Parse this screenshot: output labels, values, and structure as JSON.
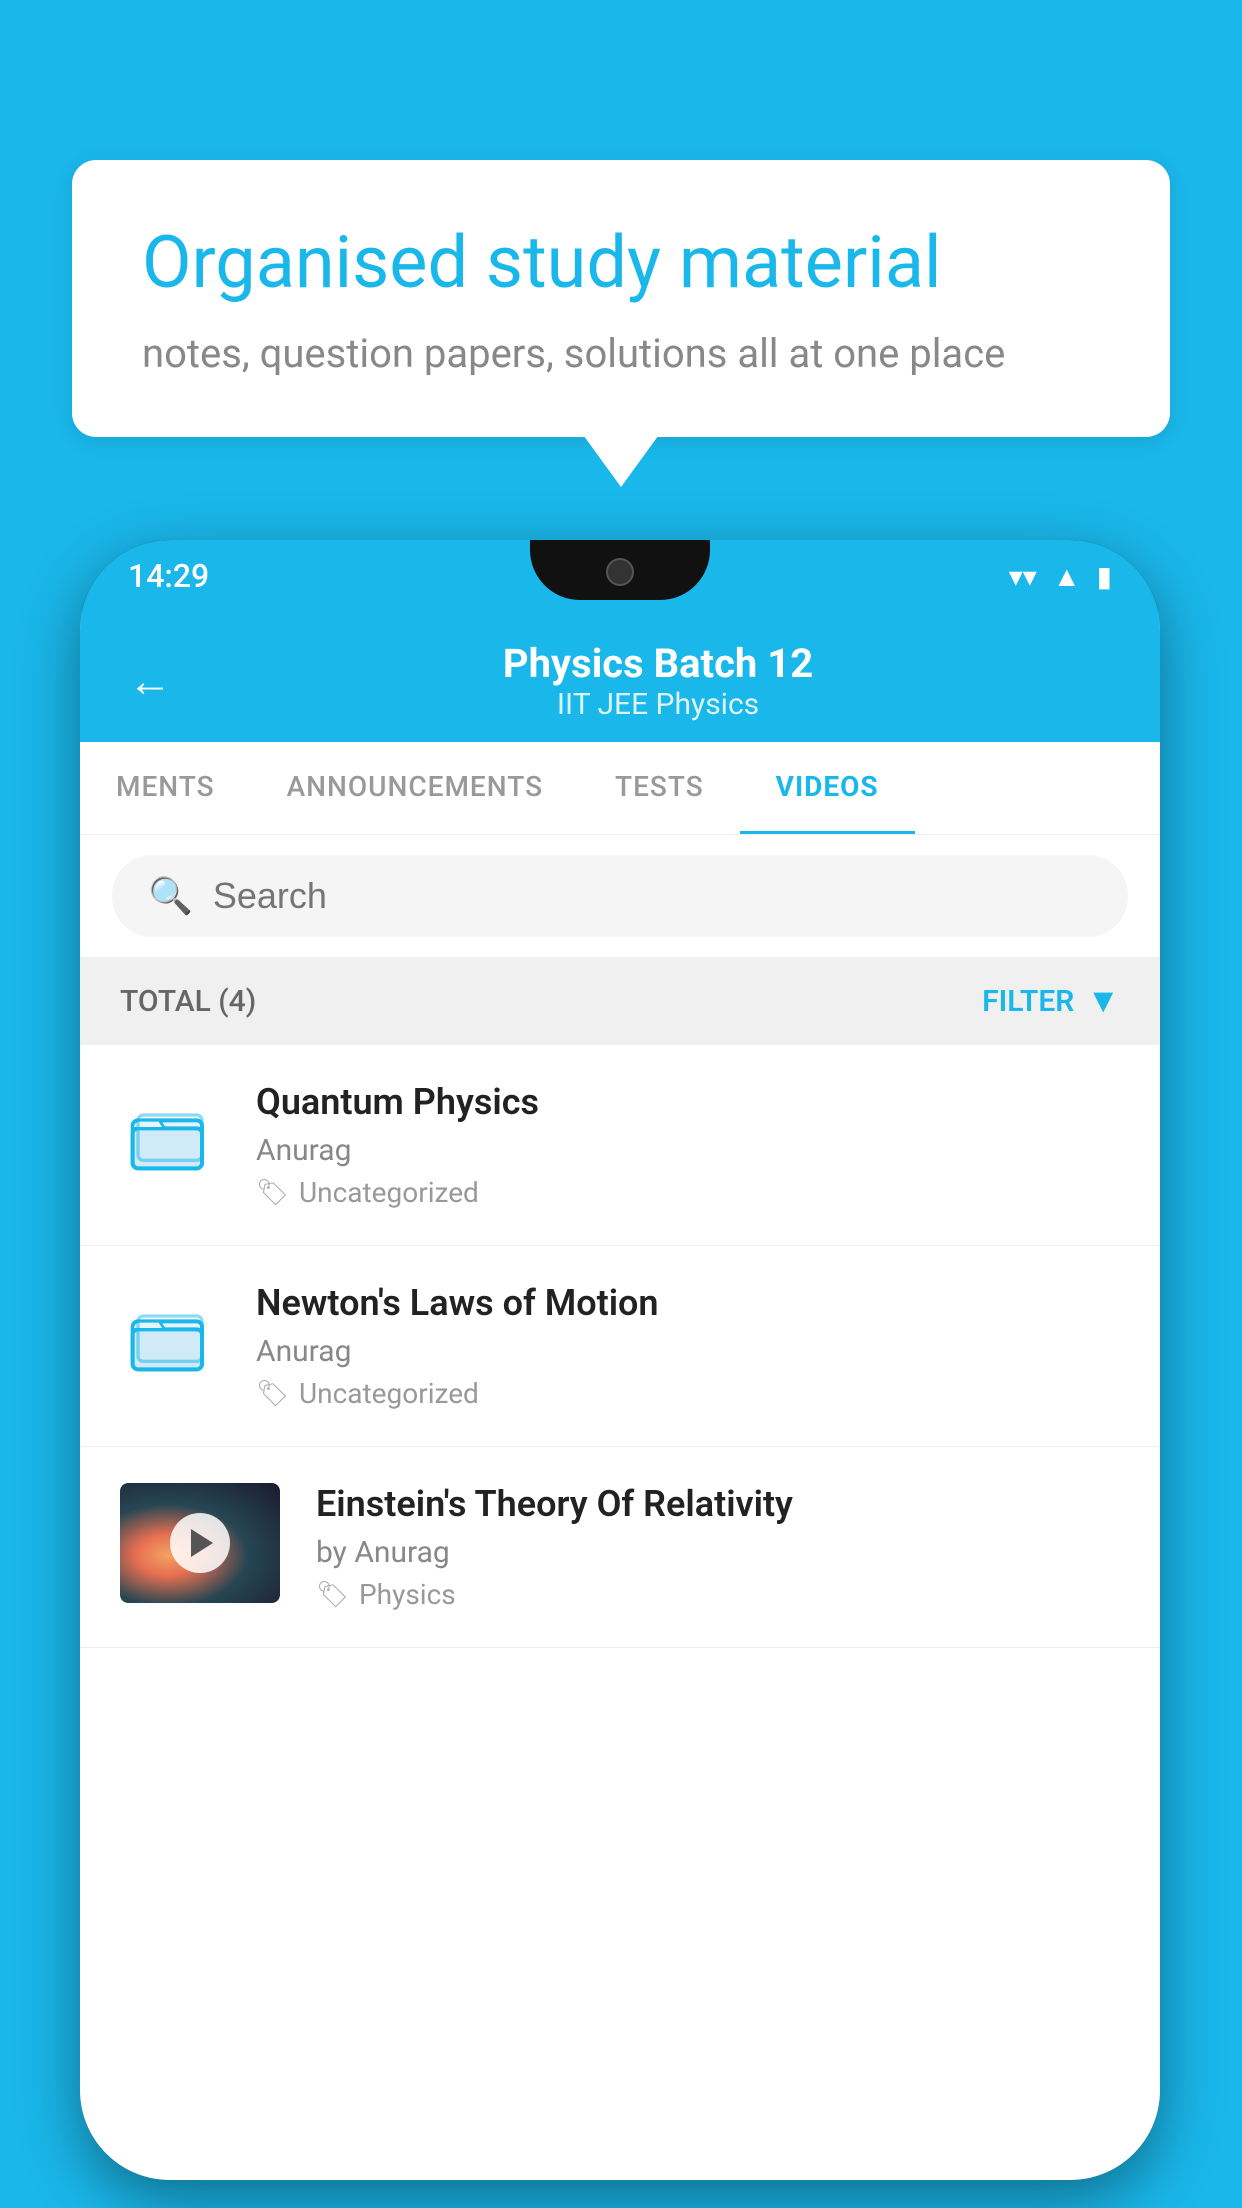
{
  "background_color": "#1ab7ea",
  "speech_bubble": {
    "title": "Organised study material",
    "subtitle": "notes, question papers, solutions all at one place"
  },
  "phone": {
    "status_bar": {
      "time": "14:29"
    },
    "header": {
      "back_label": "←",
      "title": "Physics Batch 12",
      "subtitle": "IIT JEE   Physics"
    },
    "tabs": [
      {
        "label": "MENTS",
        "active": false
      },
      {
        "label": "ANNOUNCEMENTS",
        "active": false
      },
      {
        "label": "TESTS",
        "active": false
      },
      {
        "label": "VIDEOS",
        "active": true
      }
    ],
    "search": {
      "placeholder": "Search"
    },
    "filter_bar": {
      "total_label": "TOTAL (4)",
      "filter_label": "FILTER"
    },
    "video_items": [
      {
        "id": 1,
        "title": "Quantum Physics",
        "author": "Anurag",
        "tag": "Uncategorized",
        "type": "folder",
        "has_thumb": false
      },
      {
        "id": 2,
        "title": "Newton's Laws of Motion",
        "author": "Anurag",
        "tag": "Uncategorized",
        "type": "folder",
        "has_thumb": false
      },
      {
        "id": 3,
        "title": "Einstein's Theory Of Relativity",
        "author": "by Anurag",
        "tag": "Physics",
        "type": "video",
        "has_thumb": true
      }
    ]
  }
}
